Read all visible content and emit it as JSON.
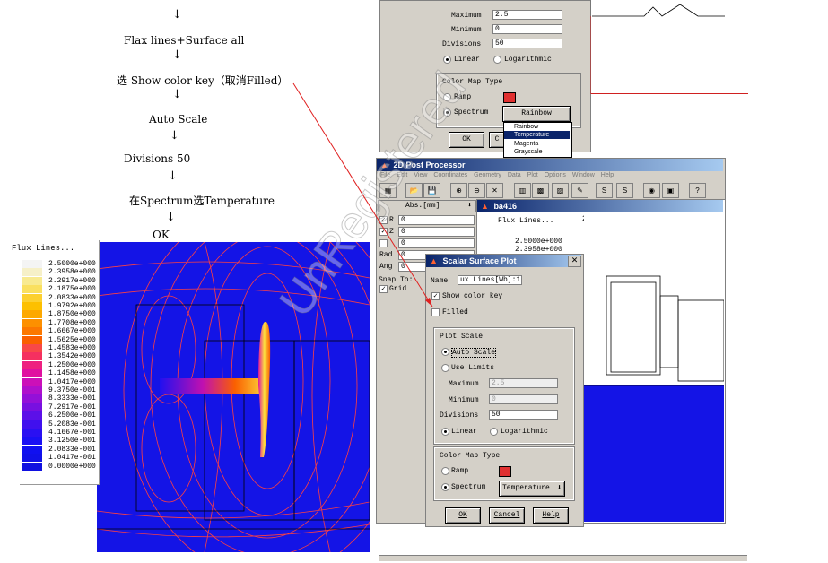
{
  "flow": {
    "steps": [
      "Flax lines+Surface all",
      "选 Show color key（取消Filled）",
      "Auto Scale",
      "Divisions 50",
      "在Spectrum选Temperature",
      "OK"
    ]
  },
  "legend": {
    "title": "Flux Lines...",
    "levels": [
      "2.5000e+000",
      "2.3958e+000",
      "2.2917e+000",
      "2.1875e+000",
      "2.0833e+000",
      "1.9792e+000",
      "1.8750e+000",
      "1.7708e+000",
      "1.6667e+000",
      "1.5625e+000",
      "1.4583e+000",
      "1.3542e+000",
      "1.2500e+000",
      "1.1458e+000",
      "1.0417e+000",
      "9.3750e-001",
      "8.3333e-001",
      "7.2917e-001",
      "6.2500e-001",
      "5.2083e-001",
      "4.1667e-001",
      "3.1250e-001",
      "2.0833e-001",
      "1.0417e-001",
      "0.0000e+000"
    ],
    "colors": [
      "#f4f4f4",
      "#f6f0c8",
      "#f8ea90",
      "#fae060",
      "#fcd030",
      "#fdc000",
      "#fda800",
      "#fd9000",
      "#fc7800",
      "#fa6000",
      "#f84848",
      "#f53060",
      "#ee2080",
      "#e010a0",
      "#cc10b8",
      "#b010cc",
      "#9410d8",
      "#7810e0",
      "#5c10e8",
      "#4010ee",
      "#2a10f2",
      "#1a10f4",
      "#1010f0",
      "#1010e8",
      "#1010e0"
    ]
  },
  "top_dialog": {
    "maximum_label": "Maximum",
    "maximum_value": "2.5",
    "minimum_label": "Minimum",
    "minimum_value": "0",
    "divisions_label": "Divisions",
    "divisions_value": "50",
    "linear_label": "Linear",
    "log_label": "Logarithmic",
    "color_map_type": "Color Map Type",
    "ramp_label": "Ramp",
    "spectrum_label": "Spectrum",
    "spectrum_value": "Rainbow",
    "ok": "OK",
    "cancel_partial": "C",
    "dropdown_options": [
      "Rainbow",
      "Temperature",
      "Magenta",
      "Grayscale"
    ],
    "dropdown_selected_index": 1
  },
  "post_processor": {
    "title": "2D Post Processor",
    "menu": [
      "File",
      "Edit",
      "View",
      "Coordinates",
      "Geometry",
      "Data",
      "Plot",
      "Options",
      "Window",
      "Help"
    ],
    "coords_header": "Abs.[mm]",
    "rows": [
      {
        "label": "R",
        "value": "0",
        "checked": true
      },
      {
        "label": "Z",
        "value": "0",
        "checked": true
      },
      {
        "label": "",
        "value": "0",
        "checked": false
      },
      {
        "label": "Rad",
        "value": "0"
      },
      {
        "label": "Ang",
        "value": "0"
      }
    ],
    "snap_label": "Snap To:",
    "grid_label": "Grid",
    "child_title": "ba416",
    "child_legend_title": "Flux Lines...",
    "child_values": [
      "2.5000e+000",
      "2.3958e+000"
    ],
    "extra_digit": "2"
  },
  "scalar_dialog": {
    "title": "Scalar Surface Plot",
    "name_label": "Name",
    "name_value": "ux Lines[Wb]:1",
    "show_color_key": "Show color key",
    "filled": "Filled",
    "plot_scale": "Plot Scale",
    "auto_scale": "Auto Scale",
    "use_limits": "Use Limits",
    "maximum_label": "Maximum",
    "maximum_value": "2.5",
    "minimum_label": "Minimum",
    "minimum_value": "0",
    "divisions_label": "Divisions",
    "divisions_value": "50",
    "linear": "Linear",
    "logarithmic": "Logarithmic",
    "color_map_type": "Color Map Type",
    "ramp": "Ramp",
    "spectrum": "Spectrum",
    "spectrum_value": "Temperature",
    "ok": "OK",
    "cancel": "Cancel",
    "help": "Help"
  },
  "watermark": "UnRegistered",
  "colors": {
    "plot_bg": "#1414e6",
    "contour": "#ff4040",
    "annotation_arrow": "#e02020",
    "title_dark": "#0a246a",
    "title_light": "#a6caf0",
    "dialog_bg": "#d4d0c8"
  }
}
